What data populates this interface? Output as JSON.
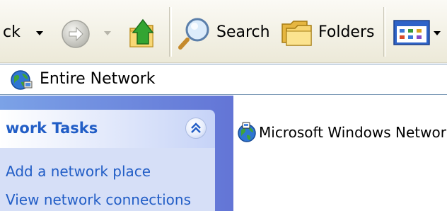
{
  "toolbar": {
    "back_label": "ck",
    "search_label": "Search",
    "folders_label": "Folders",
    "icons": {
      "back_dropdown": "chevron-down-icon",
      "forward": "forward-arrow-icon",
      "up": "up-folder-icon",
      "search": "search-icon",
      "folders": "folders-icon",
      "views": "views-icon"
    }
  },
  "address": {
    "value": "Entire Network",
    "icon": "globe-icon"
  },
  "task_pane": {
    "title": "work Tasks",
    "links": [
      "Add a network place",
      "View network connections"
    ],
    "collapse_icon": "double-chevron-up-icon"
  },
  "content": {
    "items": [
      {
        "label": "Microsoft Windows Network",
        "icon": "network-globe-icon"
      }
    ]
  },
  "colors": {
    "task_link": "#215dc6",
    "taskpane_bg": "#6375d6",
    "taskbody_bg": "#d6dff7",
    "toolbar_bg": "#ece9d8"
  }
}
